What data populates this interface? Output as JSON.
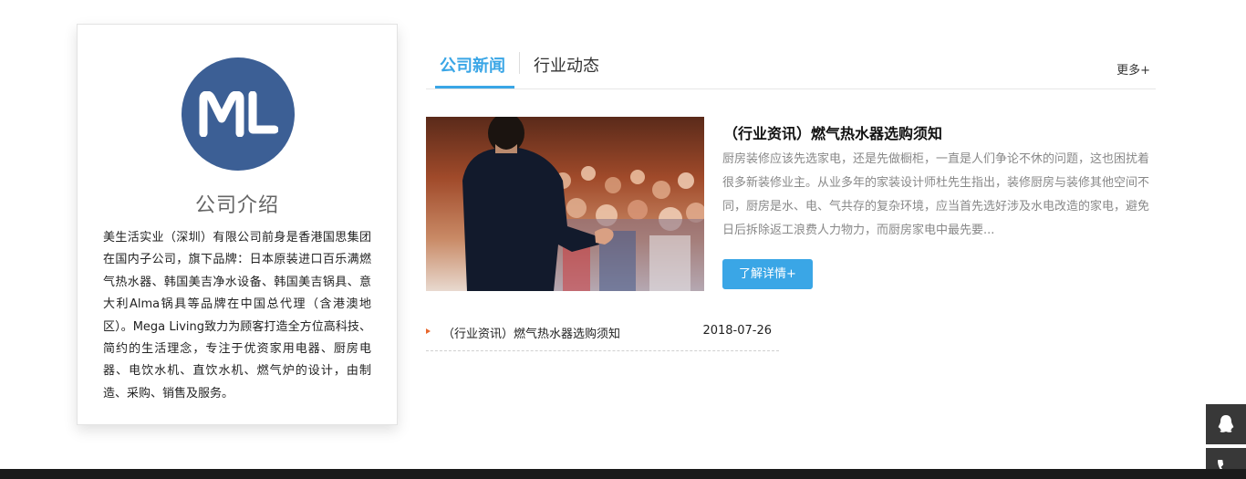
{
  "intro": {
    "logo_text": "ML",
    "title": "公司介绍",
    "description": "美生活实业（深圳）有限公司前身是香港国思集团在国内子公司，旗下品牌：日本原装进口百乐满燃气热水器、韩国美吉净水设备、韩国美吉锅具、意大利Alma锅具等品牌在中国总代理（含港澳地区）。Mega Living致力为顾客打造全方位高科技、简约的生活理念，专注于优资家用电器、厨房电器、电饮水机、直饮水机、燃气炉的设计，由制造、采购、销售及服务。"
  },
  "news": {
    "tabs": [
      {
        "label": "公司新闻"
      },
      {
        "label": "行业动态"
      }
    ],
    "more_label": "更多+",
    "featured": {
      "title": "（行业资讯）燃气热水器选购须知",
      "description": "厨房装修应该先选家电，还是先做橱柜，一直是人们争论不休的问题，这也困扰着很多新装修业主。从业多年的家装设计师杜先生指出，装修厨房与装修其他空间不同，厨房是水、电、气共存的复杂环境，应当首先选好涉及水电改造的家电，避免日后拆除返工浪费人力物力，而厨房家电中最先要...",
      "button_label": "了解详情+"
    },
    "list": [
      {
        "title": "（行业资讯）燃气热水器选购须知",
        "date": "2018-07-26"
      }
    ]
  },
  "sidebar": {
    "icons": [
      "qq-icon",
      "phone-icon"
    ]
  },
  "colors": {
    "accent": "#3aa6e6",
    "logo_bg": "#3c5f95",
    "list_arrow": "#e8672c",
    "float_bg": "#383838"
  }
}
